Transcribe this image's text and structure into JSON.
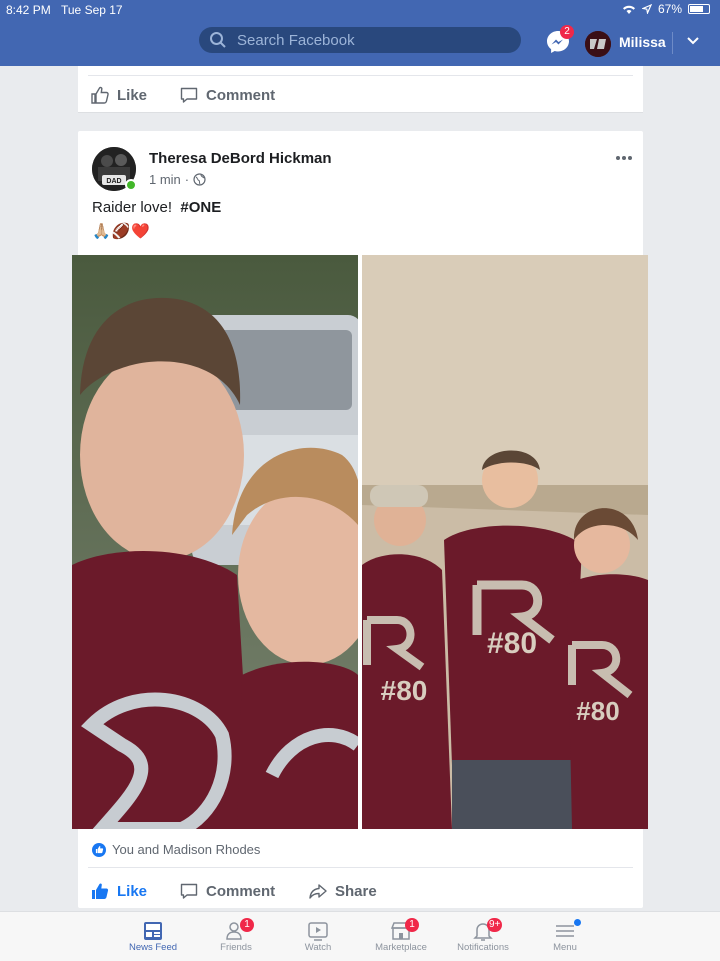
{
  "status_bar": {
    "time": "8:42 PM",
    "date": "Tue Sep 17",
    "battery": "67%"
  },
  "header": {
    "search_placeholder": "Search Facebook",
    "messenger_badge": "2",
    "user_name": "Milissa"
  },
  "previous_post": {
    "like_label": "Like",
    "comment_label": "Comment"
  },
  "post": {
    "author": "Theresa DeBord Hickman",
    "time": "1 min",
    "meta_sep": "·",
    "text": "Raider love!",
    "hashtag": "#ONE",
    "emoji": "🙏🏼🏈❤️",
    "reactions_text": "You and Madison Rhodes",
    "like_label": "Like",
    "comment_label": "Comment",
    "share_label": "Share",
    "shirt_number": "#80",
    "avatar_text": "DAD"
  },
  "bottom_nav": {
    "tabs": [
      {
        "label": "News Feed",
        "icon": "news-feed-icon",
        "active": true
      },
      {
        "label": "Friends",
        "icon": "friends-icon",
        "badge": "1"
      },
      {
        "label": "Watch",
        "icon": "watch-icon"
      },
      {
        "label": "Marketplace",
        "icon": "marketplace-icon",
        "badge": "1"
      },
      {
        "label": "Notifications",
        "icon": "bell-icon",
        "badge": "9+"
      },
      {
        "label": "Menu",
        "icon": "menu-icon"
      }
    ]
  },
  "colors": {
    "brand": "#4267b2",
    "like_blue": "#1877f2",
    "badge_red": "#f02849",
    "maroon_shirt": "#6b1a2a"
  }
}
